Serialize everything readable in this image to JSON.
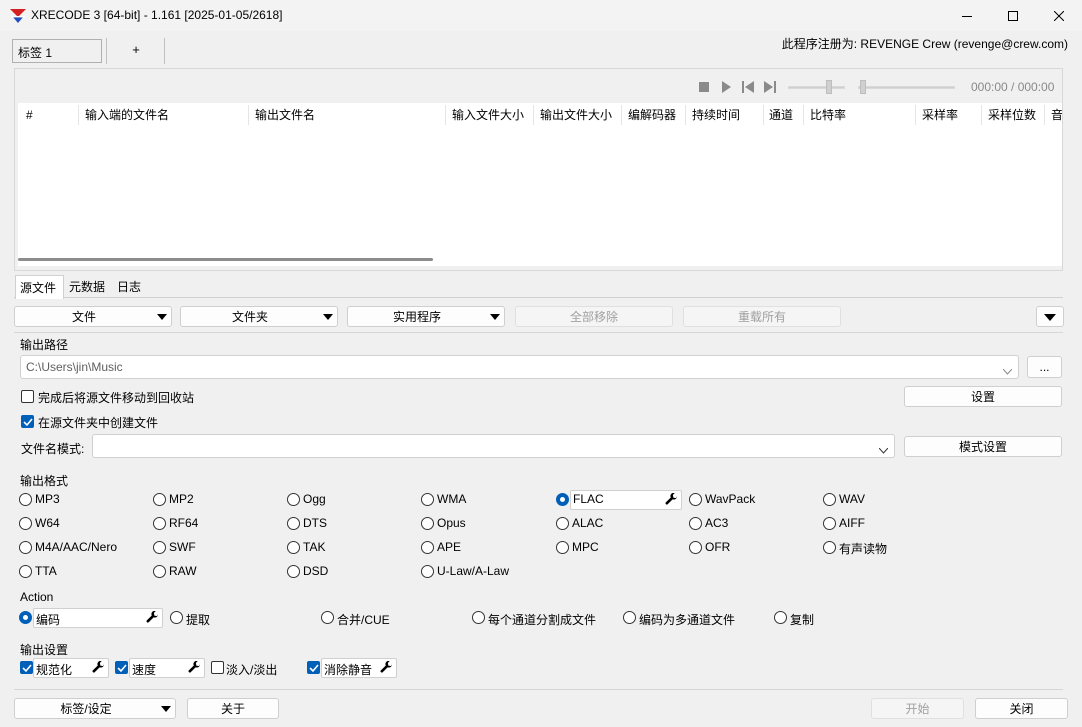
{
  "window": {
    "title": "XRECODE 3 [64-bit] - 1.161 [2025-01-05/2618]"
  },
  "tabs": {
    "current": "标签 1",
    "add_label": "+"
  },
  "registration": "此程序注册为: REVENGE Crew (revenge@crew.com)",
  "player": {
    "time": "000:00 / 000:00"
  },
  "file_list": {
    "columns": [
      "#",
      "输入端的文件名",
      "输出文件名",
      "输入文件大小",
      "输出文件大小",
      "编解码器",
      "持续时间",
      "通道",
      "比特率",
      "采样率",
      "采样位数",
      "音"
    ],
    "rows": []
  },
  "bottom_tabs": [
    "源文件",
    "元数据",
    "日志"
  ],
  "toolbar": {
    "file": "文件",
    "folder": "文件夹",
    "utility": "实用程序",
    "remove_all": "全部移除",
    "reload_all": "重载所有"
  },
  "output_path": {
    "title": "输出路径",
    "value": "C:\\Users\\jin\\Music",
    "browse": "...",
    "move_to_recycle": "完成后将源文件移动到回收站",
    "create_in_source": "在源文件夹中创建文件",
    "settings": "设置",
    "filename_pattern_label": "文件名模式:",
    "filename_pattern_value": "",
    "pattern_settings": "模式设置"
  },
  "output_format": {
    "title": "输出格式",
    "selected": "FLAC",
    "rows": [
      [
        "MP3",
        "MP2",
        "Ogg",
        "WMA",
        "FLAC",
        "WavPack",
        "WAV"
      ],
      [
        "W64",
        "RF64",
        "DTS",
        "Opus",
        "ALAC",
        "AC3",
        "AIFF"
      ],
      [
        "M4A/AAC/Nero",
        "SWF",
        "TAK",
        "APE",
        "MPC",
        "OFR",
        "有声读物"
      ],
      [
        "TTA",
        "RAW",
        "DSD",
        "U-Law/A-Law"
      ]
    ]
  },
  "action": {
    "title": "Action",
    "selected": "编码",
    "options": [
      "编码",
      "提取",
      "合并/CUE",
      "每个通道分割成文件",
      "编码为多通道文件",
      "复制"
    ]
  },
  "output_settings": {
    "title": "输出设置",
    "normalize": "规范化",
    "speed": "速度",
    "fade": "淡入/淡出",
    "remove_silence": "消除静音"
  },
  "footer": {
    "tabs_settings": "标签/设定",
    "about": "关于",
    "start": "开始",
    "close": "关闭"
  },
  "colors": {
    "accent": "#005fb8",
    "background": "#f0f0f0"
  }
}
